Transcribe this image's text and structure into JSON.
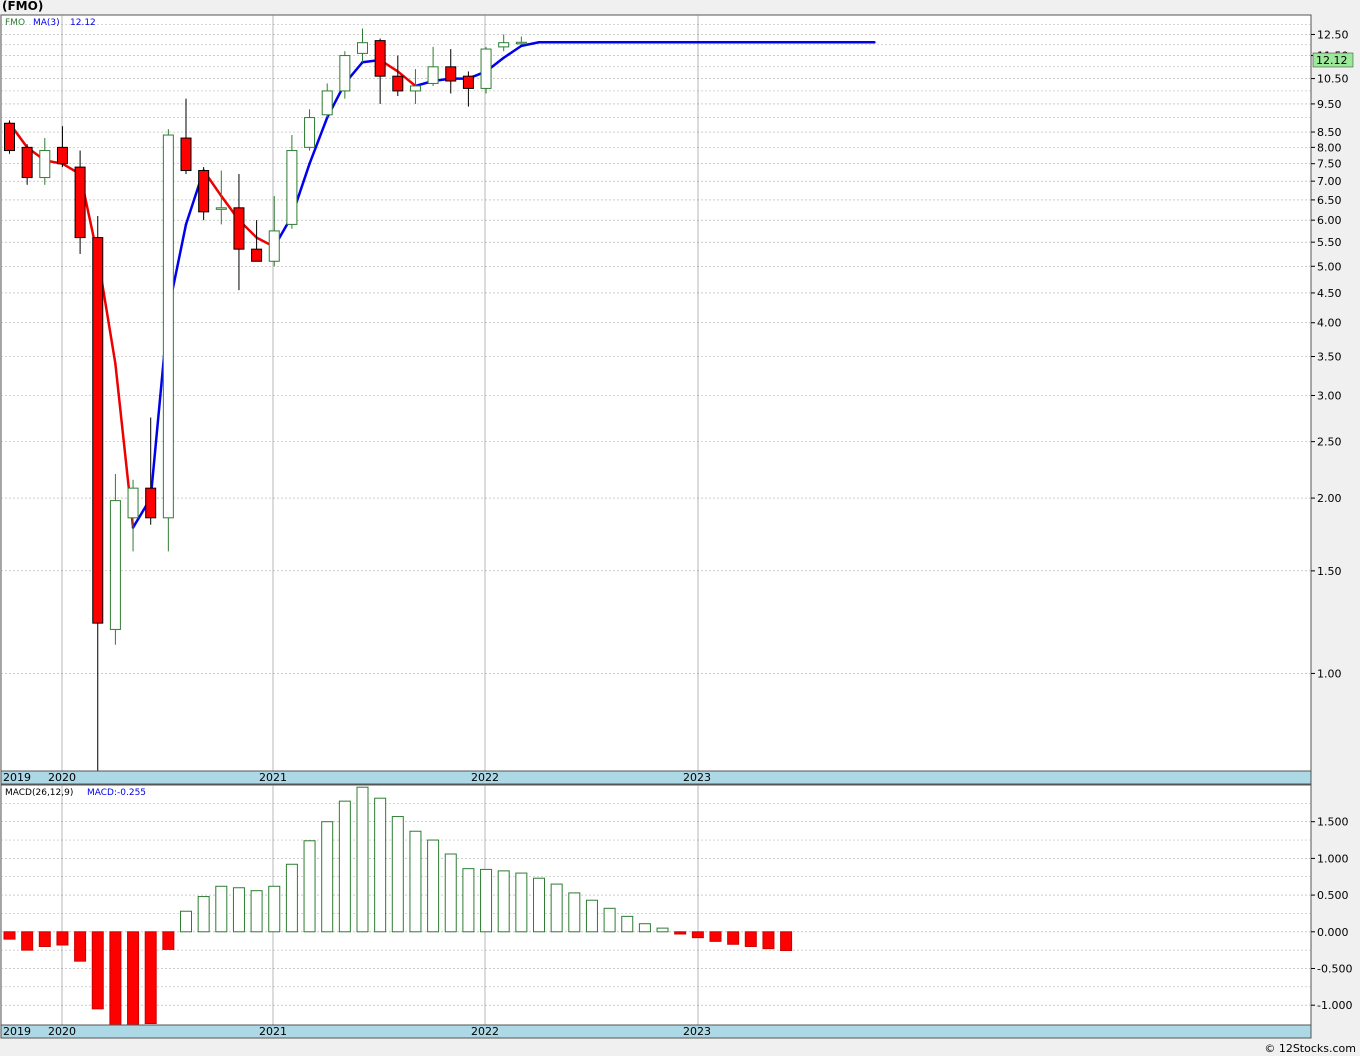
{
  "title": "(FMO)",
  "credit": "© 12Stocks.com",
  "colors": {
    "up_candle": "#2e7d32",
    "down_candle": "#ff0000",
    "ma_up": "#0000ee",
    "ma_down": "#ee0000",
    "date_bar": "#add8e6",
    "last_price_box": "#9be89b",
    "grid": "#aaaaaa"
  },
  "price_panel": {
    "legend": {
      "symbol": "FMO",
      "indicator": "MA(3)",
      "value": "12.12"
    },
    "last_price_label": "12.12",
    "y_ticks": [
      "12.50",
      "11.50",
      "10.50",
      "9.50",
      "8.50",
      "8.00",
      "7.50",
      "7.00",
      "6.50",
      "6.00",
      "5.50",
      "5.00",
      "4.50",
      "4.00",
      "3.50",
      "3.00",
      "2.50",
      "2.00",
      "1.50",
      "1.00"
    ],
    "x_labels": [
      "2019",
      "2020",
      "2021",
      "2022",
      "2023"
    ]
  },
  "macd_panel": {
    "legend": {
      "name": "MACD(26,12,9)",
      "value_label": "MACD:-0.255"
    },
    "y_ticks": [
      "1.500",
      "1.000",
      "0.500",
      "0.000",
      "-0.500",
      "-1.000"
    ],
    "x_labels": [
      "2019",
      "2020",
      "2021",
      "2022",
      "2023"
    ]
  },
  "chart_data": [
    {
      "type": "candlestick",
      "title": "(FMO)",
      "scale": "log",
      "ylim": [
        0.68,
        13.5
      ],
      "periods": [
        "2019-12",
        "2020-01",
        "2020-02",
        "2020-03",
        "2020-04",
        "2020-05",
        "2020-06",
        "2020-07",
        "2020-08",
        "2020-09",
        "2020-10",
        "2020-11",
        "2020-12",
        "2021-01",
        "2021-02",
        "2021-03",
        "2021-04",
        "2021-05",
        "2021-06",
        "2021-07",
        "2021-08",
        "2021-09",
        "2021-10",
        "2021-11",
        "2021-12",
        "2022-01",
        "2022-02",
        "2022-03",
        "2022-04",
        "2022-05",
        "2022-06",
        "2022-07",
        "2022-08",
        "2022-09",
        "2022-10",
        "2022-11",
        "2022-12",
        "2023-01",
        "2023-02",
        "2023-03",
        "2023-04",
        "2023-05",
        "2023-06",
        "2023-07",
        "2023-08",
        "2023-09",
        "2023-10",
        "2023-11",
        "2023-12",
        "2024-01"
      ],
      "candles": [
        {
          "open": 8.8,
          "high": 8.9,
          "low": 7.8,
          "close": 7.9
        },
        {
          "open": 8.0,
          "high": 8.1,
          "low": 6.9,
          "close": 7.1
        },
        {
          "open": 7.1,
          "high": 8.3,
          "low": 6.9,
          "close": 7.9
        },
        {
          "open": 8.0,
          "high": 8.7,
          "low": 7.4,
          "close": 7.5
        },
        {
          "open": 7.4,
          "high": 7.9,
          "low": 5.25,
          "close": 5.6
        },
        {
          "open": 5.6,
          "high": 6.1,
          "low": 0.68,
          "close": 1.22
        },
        {
          "open": 1.19,
          "high": 2.2,
          "low": 1.12,
          "close": 1.98
        },
        {
          "open": 1.85,
          "high": 2.15,
          "low": 1.62,
          "close": 2.08
        },
        {
          "open": 2.08,
          "high": 2.75,
          "low": 1.8,
          "close": 1.85
        },
        {
          "open": 1.85,
          "high": 8.6,
          "low": 1.62,
          "close": 8.4
        },
        {
          "open": 8.3,
          "high": 9.7,
          "low": 7.2,
          "close": 7.3
        },
        {
          "open": 7.3,
          "high": 7.4,
          "low": 6.0,
          "close": 6.2
        },
        {
          "open": 6.3,
          "high": 7.3,
          "low": 5.9,
          "close": 6.3
        },
        {
          "open": 6.3,
          "high": 7.2,
          "low": 4.55,
          "close": 5.35
        },
        {
          "open": 5.35,
          "high": 6.0,
          "low": 5.1,
          "close": 5.1
        },
        {
          "open": 5.1,
          "high": 6.6,
          "low": 5.0,
          "close": 5.75
        },
        {
          "open": 5.9,
          "high": 8.4,
          "low": 5.8,
          "close": 7.9
        },
        {
          "open": 8.0,
          "high": 9.3,
          "low": 7.9,
          "close": 9.0
        },
        {
          "open": 9.1,
          "high": 10.3,
          "low": 9.0,
          "close": 10.0
        },
        {
          "open": 10.0,
          "high": 11.7,
          "low": 9.7,
          "close": 11.5
        },
        {
          "open": 11.6,
          "high": 12.8,
          "low": 11.2,
          "close": 12.1
        },
        {
          "open": 12.2,
          "high": 12.3,
          "low": 9.5,
          "close": 10.6
        },
        {
          "open": 10.6,
          "high": 11.5,
          "low": 9.8,
          "close": 10.0
        },
        {
          "open": 10.0,
          "high": 10.9,
          "low": 9.5,
          "close": 10.2
        },
        {
          "open": 10.3,
          "high": 11.9,
          "low": 10.2,
          "close": 11.0
        },
        {
          "open": 11.0,
          "high": 11.8,
          "low": 9.9,
          "close": 10.4
        },
        {
          "open": 10.6,
          "high": 10.8,
          "low": 9.4,
          "close": 10.1
        },
        {
          "open": 10.1,
          "high": 11.9,
          "low": 9.9,
          "close": 11.8
        },
        {
          "open": 11.9,
          "high": 12.5,
          "low": 11.7,
          "close": 12.1
        },
        {
          "open": 12.1,
          "high": 12.4,
          "low": 12.0,
          "close": 12.12
        }
      ],
      "moving_average": {
        "name": "MA(3)",
        "values": [
          8.8,
          8.0,
          7.6,
          7.5,
          7.2,
          5.2,
          3.4,
          1.78,
          2.0,
          4.2,
          5.9,
          7.3,
          6.6,
          6.0,
          5.6,
          5.4,
          6.1,
          7.5,
          9.0,
          10.3,
          11.2,
          11.3,
          10.8,
          10.2,
          10.4,
          10.5,
          10.5,
          10.8,
          11.4,
          11.95,
          12.12,
          12.12,
          12.12,
          12.12,
          12.12,
          12.12,
          12.12,
          12.12,
          12.12,
          12.12,
          12.12,
          12.12,
          12.12,
          12.12,
          12.12,
          12.12,
          12.12,
          12.12,
          12.12,
          12.12
        ]
      }
    },
    {
      "type": "bar",
      "title": "MACD(26,12,9)",
      "ylim": [
        -1.27,
        2.0
      ],
      "values": [
        -0.1,
        -0.25,
        -0.2,
        -0.18,
        -0.4,
        -1.05,
        -1.28,
        -1.28,
        -1.25,
        -0.24,
        0.28,
        0.48,
        0.62,
        0.6,
        0.56,
        0.62,
        0.92,
        1.24,
        1.5,
        1.78,
        1.97,
        1.82,
        1.57,
        1.37,
        1.25,
        1.06,
        0.86,
        0.85,
        0.83,
        0.8,
        0.73,
        0.65,
        0.53,
        0.43,
        0.32,
        0.21,
        0.11,
        0.05,
        -0.03,
        -0.08,
        -0.13,
        -0.17,
        -0.2,
        -0.23,
        -0.255
      ]
    }
  ]
}
